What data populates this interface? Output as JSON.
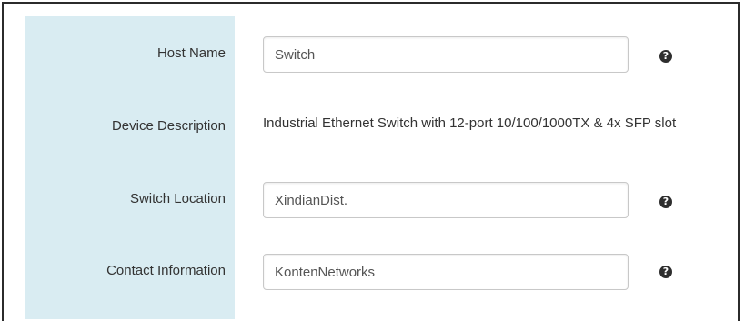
{
  "form": {
    "host_name": {
      "label": "Host Name",
      "value": "Switch",
      "help_icon": "question-circle-icon",
      "help_glyph": "?"
    },
    "device_description": {
      "label": "Device Description",
      "value": "Industrial Ethernet Switch with 12-port 10/100/1000TX & 4x SFP slot"
    },
    "switch_location": {
      "label": "Switch Location",
      "value": "XindianDist.",
      "help_icon": "question-circle-icon",
      "help_glyph": "?"
    },
    "contact_information": {
      "label": "Contact Information",
      "value": "KontenNetworks",
      "help_icon": "question-circle-icon",
      "help_glyph": "?"
    }
  },
  "colors": {
    "label_column_bg": "#d9ecf2",
    "frame_border": "#2b2b2b",
    "help_icon": "#2e2e2e"
  }
}
